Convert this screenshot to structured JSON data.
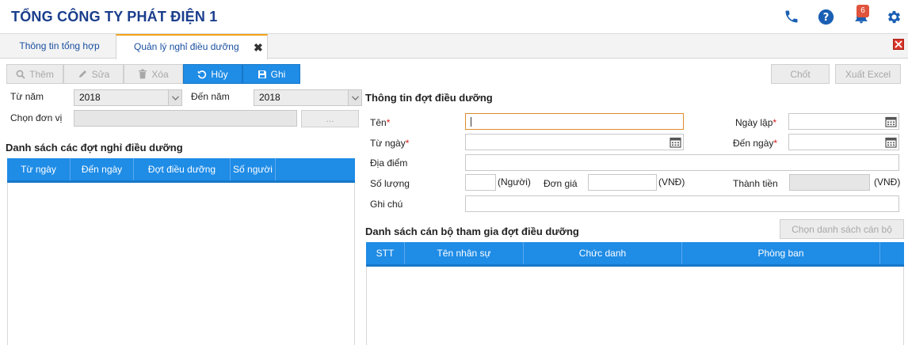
{
  "app": {
    "title": "TỔNG CÔNG TY PHÁT ĐIỆN 1",
    "notification_count": "6"
  },
  "tabs": [
    {
      "label": "Thông tin tổng hợp"
    },
    {
      "label": "Quản lý nghỉ điều dưỡng"
    }
  ],
  "toolbar": {
    "add_label": "Thêm",
    "edit_label": "Sửa",
    "delete_label": "Xóa",
    "cancel_label": "Hủy",
    "save_label": "Ghi",
    "close_out_label": "Chốt",
    "export_label": "Xuất Excel"
  },
  "filter": {
    "from_year_label": "Từ năm",
    "from_year_value": "2018",
    "to_year_label": "Đến năm",
    "to_year_value": "2018",
    "unit_label": "Chọn đơn vị",
    "unit_button": "..."
  },
  "session_list": {
    "title": "Danh sách các đợt nghỉ điều dưỡng",
    "columns": [
      "Từ ngày",
      "Đến ngày",
      "Đợt điều dưỡng",
      "Số người"
    ]
  },
  "session_info": {
    "title": "Thông tin đợt điều dưỡng",
    "name_label": "Tên",
    "created_date_label": "Ngày lập",
    "from_date_label": "Từ ngày",
    "to_date_label": "Đến ngày",
    "location_label": "Địa điểm",
    "quantity_label": "Số lượng",
    "quantity_unit": "(Người)",
    "unit_price_label": "Đơn giá",
    "unit_price_unit": "(VNĐ)",
    "total_label": "Thành tiền",
    "total_unit": "(VNĐ)",
    "note_label": "Ghi chú",
    "required_mark": "*"
  },
  "staff_list": {
    "title": "Danh sách cán bộ tham gia đợt điều dưỡng",
    "choose_button": "Chọn danh sách cán bộ",
    "columns": [
      "STT",
      "Tên nhân sự",
      "Chức danh",
      "Phòng ban"
    ]
  },
  "colors": {
    "brand": "#1a3e8c",
    "accent": "#1f8ce6",
    "tab_indicator": "#f0a21a",
    "required": "#d51a1a"
  }
}
